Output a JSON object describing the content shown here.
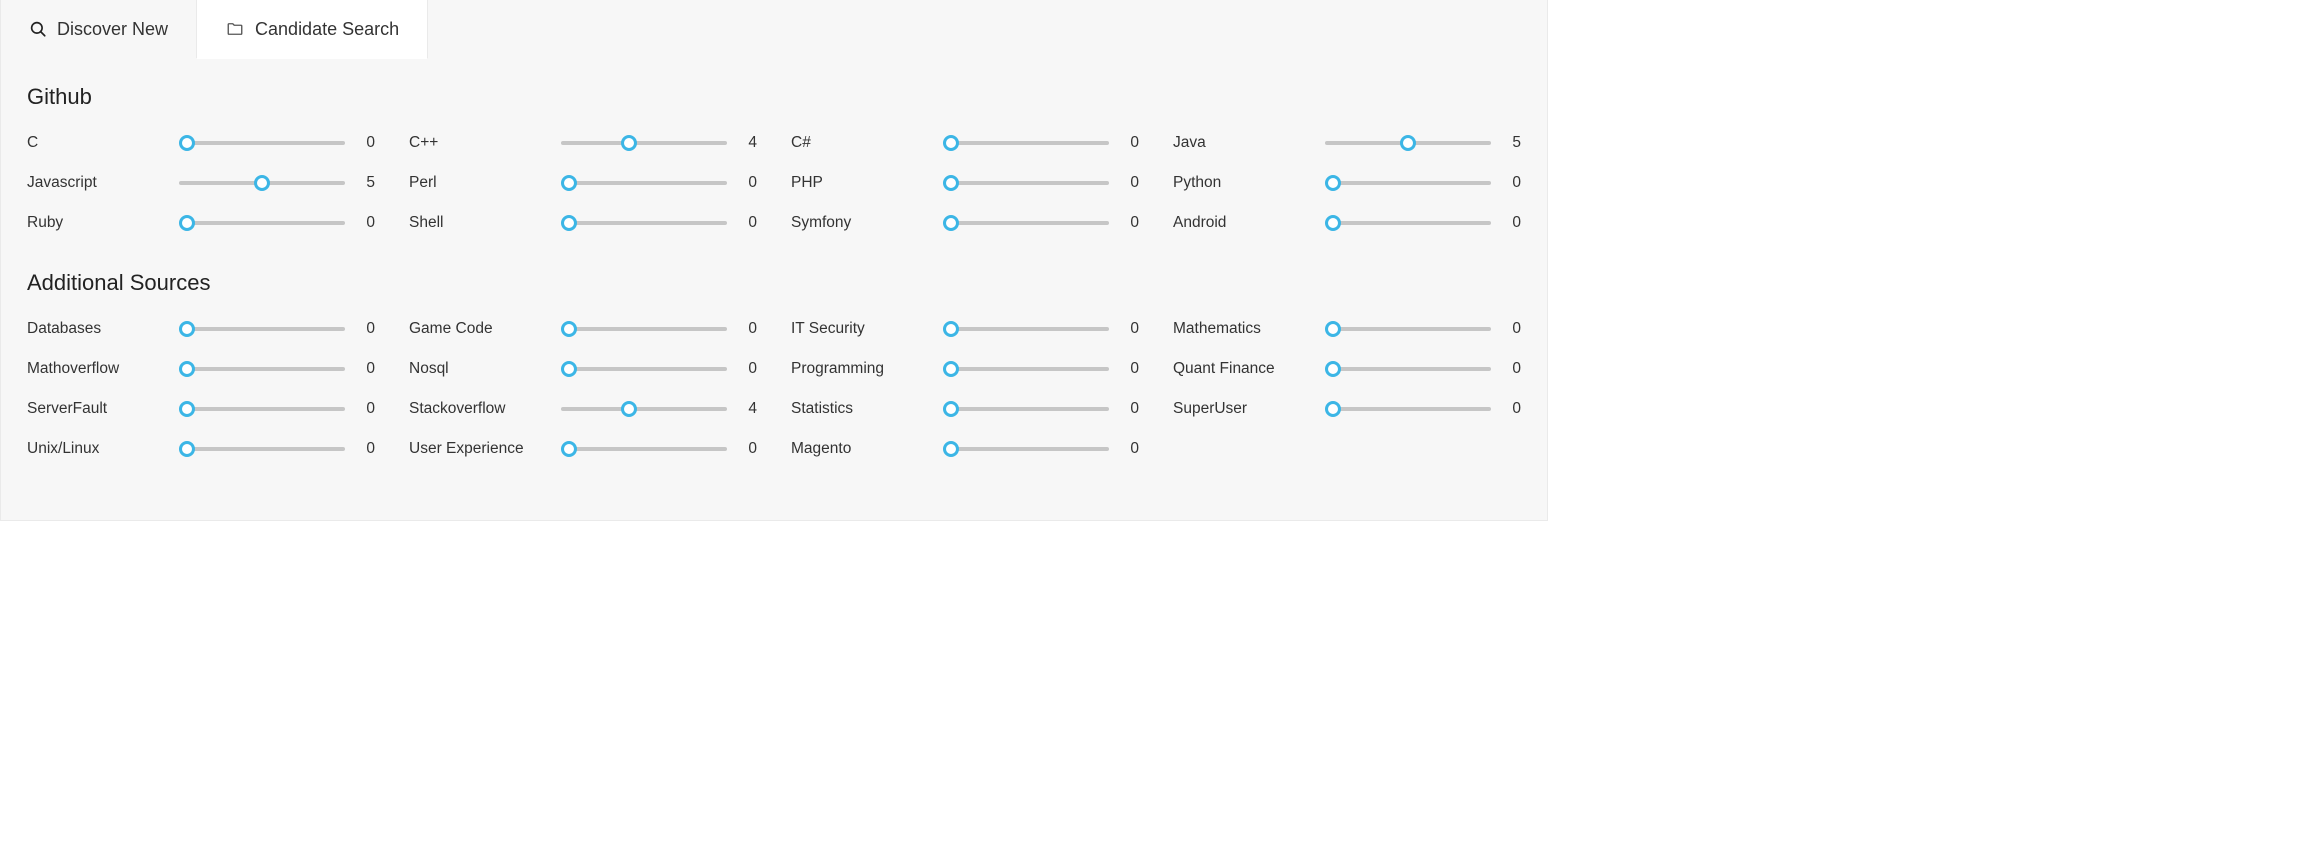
{
  "tabs": [
    {
      "icon": "search-icon",
      "label": "Discover New",
      "active": false
    },
    {
      "icon": "folder-icon",
      "label": "Candidate Search",
      "active": true
    }
  ],
  "slider_max": 10,
  "sections": [
    {
      "title": "Github",
      "items": [
        {
          "label": "C",
          "value": 0
        },
        {
          "label": "C++",
          "value": 4
        },
        {
          "label": "C#",
          "value": 0
        },
        {
          "label": "Java",
          "value": 5
        },
        {
          "label": "Javascript",
          "value": 5
        },
        {
          "label": "Perl",
          "value": 0
        },
        {
          "label": "PHP",
          "value": 0
        },
        {
          "label": "Python",
          "value": 0
        },
        {
          "label": "Ruby",
          "value": 0
        },
        {
          "label": "Shell",
          "value": 0
        },
        {
          "label": "Symfony",
          "value": 0
        },
        {
          "label": "Android",
          "value": 0
        }
      ]
    },
    {
      "title": "Additional Sources",
      "items": [
        {
          "label": "Databases",
          "value": 0
        },
        {
          "label": "Game Code",
          "value": 0
        },
        {
          "label": "IT Security",
          "value": 0
        },
        {
          "label": "Mathematics",
          "value": 0
        },
        {
          "label": "Mathoverflow",
          "value": 0
        },
        {
          "label": "Nosql",
          "value": 0
        },
        {
          "label": "Programming",
          "value": 0
        },
        {
          "label": "Quant Finance",
          "value": 0
        },
        {
          "label": "ServerFault",
          "value": 0
        },
        {
          "label": "Stackoverflow",
          "value": 4
        },
        {
          "label": "Statistics",
          "value": 0
        },
        {
          "label": "SuperUser",
          "value": 0
        },
        {
          "label": "Unix/Linux",
          "value": 0
        },
        {
          "label": "User Experience",
          "value": 0
        },
        {
          "label": "Magento",
          "value": 0
        }
      ]
    }
  ]
}
